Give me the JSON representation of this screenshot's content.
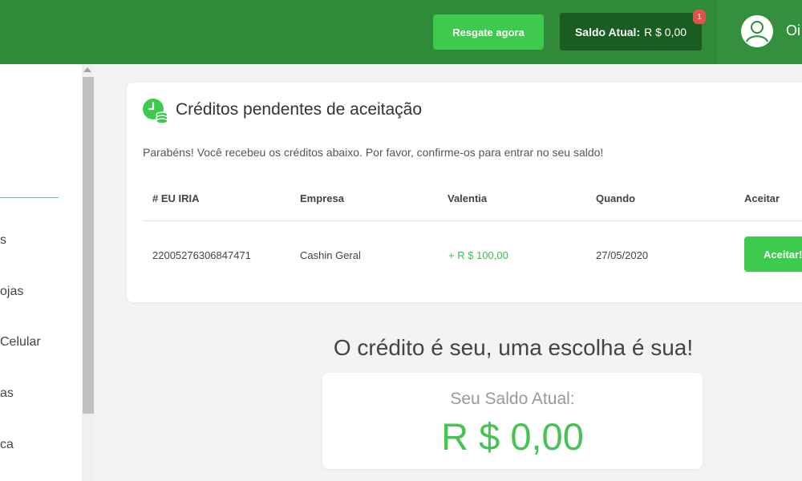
{
  "header": {
    "resgate_label": "Resgate agora",
    "saldo_label": "Saldo Atual:",
    "saldo_value": "R $ 0,00",
    "notification_count": "1",
    "user_name": "Oi",
    "colors": {
      "bar": "#2f8a3a",
      "button": "#3ccb4c",
      "saldo_bg": "#1b5c23",
      "badge": "#e35050"
    }
  },
  "sidebar": {
    "items": [
      {
        "label": "s"
      },
      {
        "label": "ojas"
      },
      {
        "label": "Celular"
      },
      {
        "label": "as"
      },
      {
        "label": "ca"
      }
    ]
  },
  "pending": {
    "title": "Créditos pendentes de aceitação",
    "subtitle": "Parabéns! Você recebeu os créditos abaixo. Por favor, confirme-os para entrar no seu saldo!",
    "columns": [
      "# EU IRIA",
      "Empresa",
      "Valentia",
      "Quando",
      "Aceitar"
    ],
    "rows": [
      {
        "id": "22005276306847471",
        "empresa": "Cashin Geral",
        "valor": "+ R $ 100,00",
        "quando": "27/05/2020",
        "aceitar_label": "Aceitar!"
      }
    ]
  },
  "summary": {
    "slogan": "O crédito é seu, uma escolha é sua!",
    "balance_label": "Seu Saldo Atual:",
    "balance_value": "R $ 0,00",
    "accent_color": "#47c255"
  }
}
